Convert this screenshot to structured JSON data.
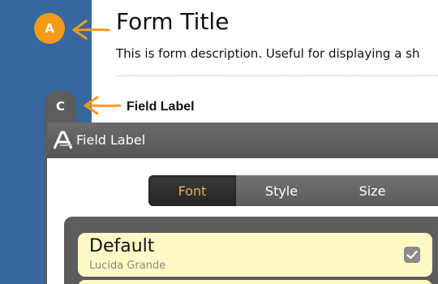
{
  "callouts": {
    "a": "A",
    "c": "C"
  },
  "form": {
    "title": "Form Title",
    "description": "This is form description. Useful for displaying a sh"
  },
  "field": {
    "label": "Field Label"
  },
  "font_panel": {
    "header_title": "Field Label",
    "tabs": [
      {
        "label": "Font",
        "selected": true
      },
      {
        "label": "Style",
        "selected": false
      },
      {
        "label": "Size",
        "selected": false
      }
    ],
    "fonts": [
      {
        "name": "Default",
        "family": "Lucida Grande",
        "checked": true
      }
    ]
  },
  "colors": {
    "sidebar_blue": "#36679f",
    "callout_orange": "#f49a1a",
    "panel_gray": "#5d5d5d",
    "selected_tab_text": "#e8ad56",
    "list_item_bg": "#fef9c5"
  },
  "icons": {
    "panel": "font-a-icon",
    "callout": "arrow-icon",
    "check": "checkmark-icon"
  }
}
